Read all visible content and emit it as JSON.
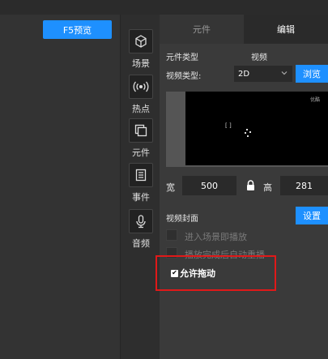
{
  "header": {
    "preview_label": "F5预览"
  },
  "toolbar": {
    "items": [
      {
        "label": "场景",
        "icon": "cube-icon"
      },
      {
        "label": "热点",
        "icon": "broadcast-icon"
      },
      {
        "label": "元件",
        "icon": "layers-icon"
      },
      {
        "label": "事件",
        "icon": "list-icon"
      },
      {
        "label": "音频",
        "icon": "microphone-icon"
      }
    ]
  },
  "tabs": {
    "elements": "元件",
    "edit": "编辑"
  },
  "editor": {
    "component_type_label": "元件类型",
    "component_type_value": "视频",
    "video_type_label": "视频类型:",
    "video_type_value": "2D",
    "browse_label": "浏览",
    "video_watermark": "优酷",
    "video_cursor": "[ ]",
    "width_label": "宽",
    "width_value": "500",
    "height_label": "高",
    "height_value": "281",
    "cover_label": "视频封面",
    "set_label": "设置",
    "autoplay_label": "进入场景即播放",
    "replay_label": "播放完成后自动重播",
    "allow_drag_label": "允许拖动",
    "allow_drag_checked": true
  },
  "colors": {
    "accent": "#1e90ff",
    "highlight": "#e01919"
  }
}
